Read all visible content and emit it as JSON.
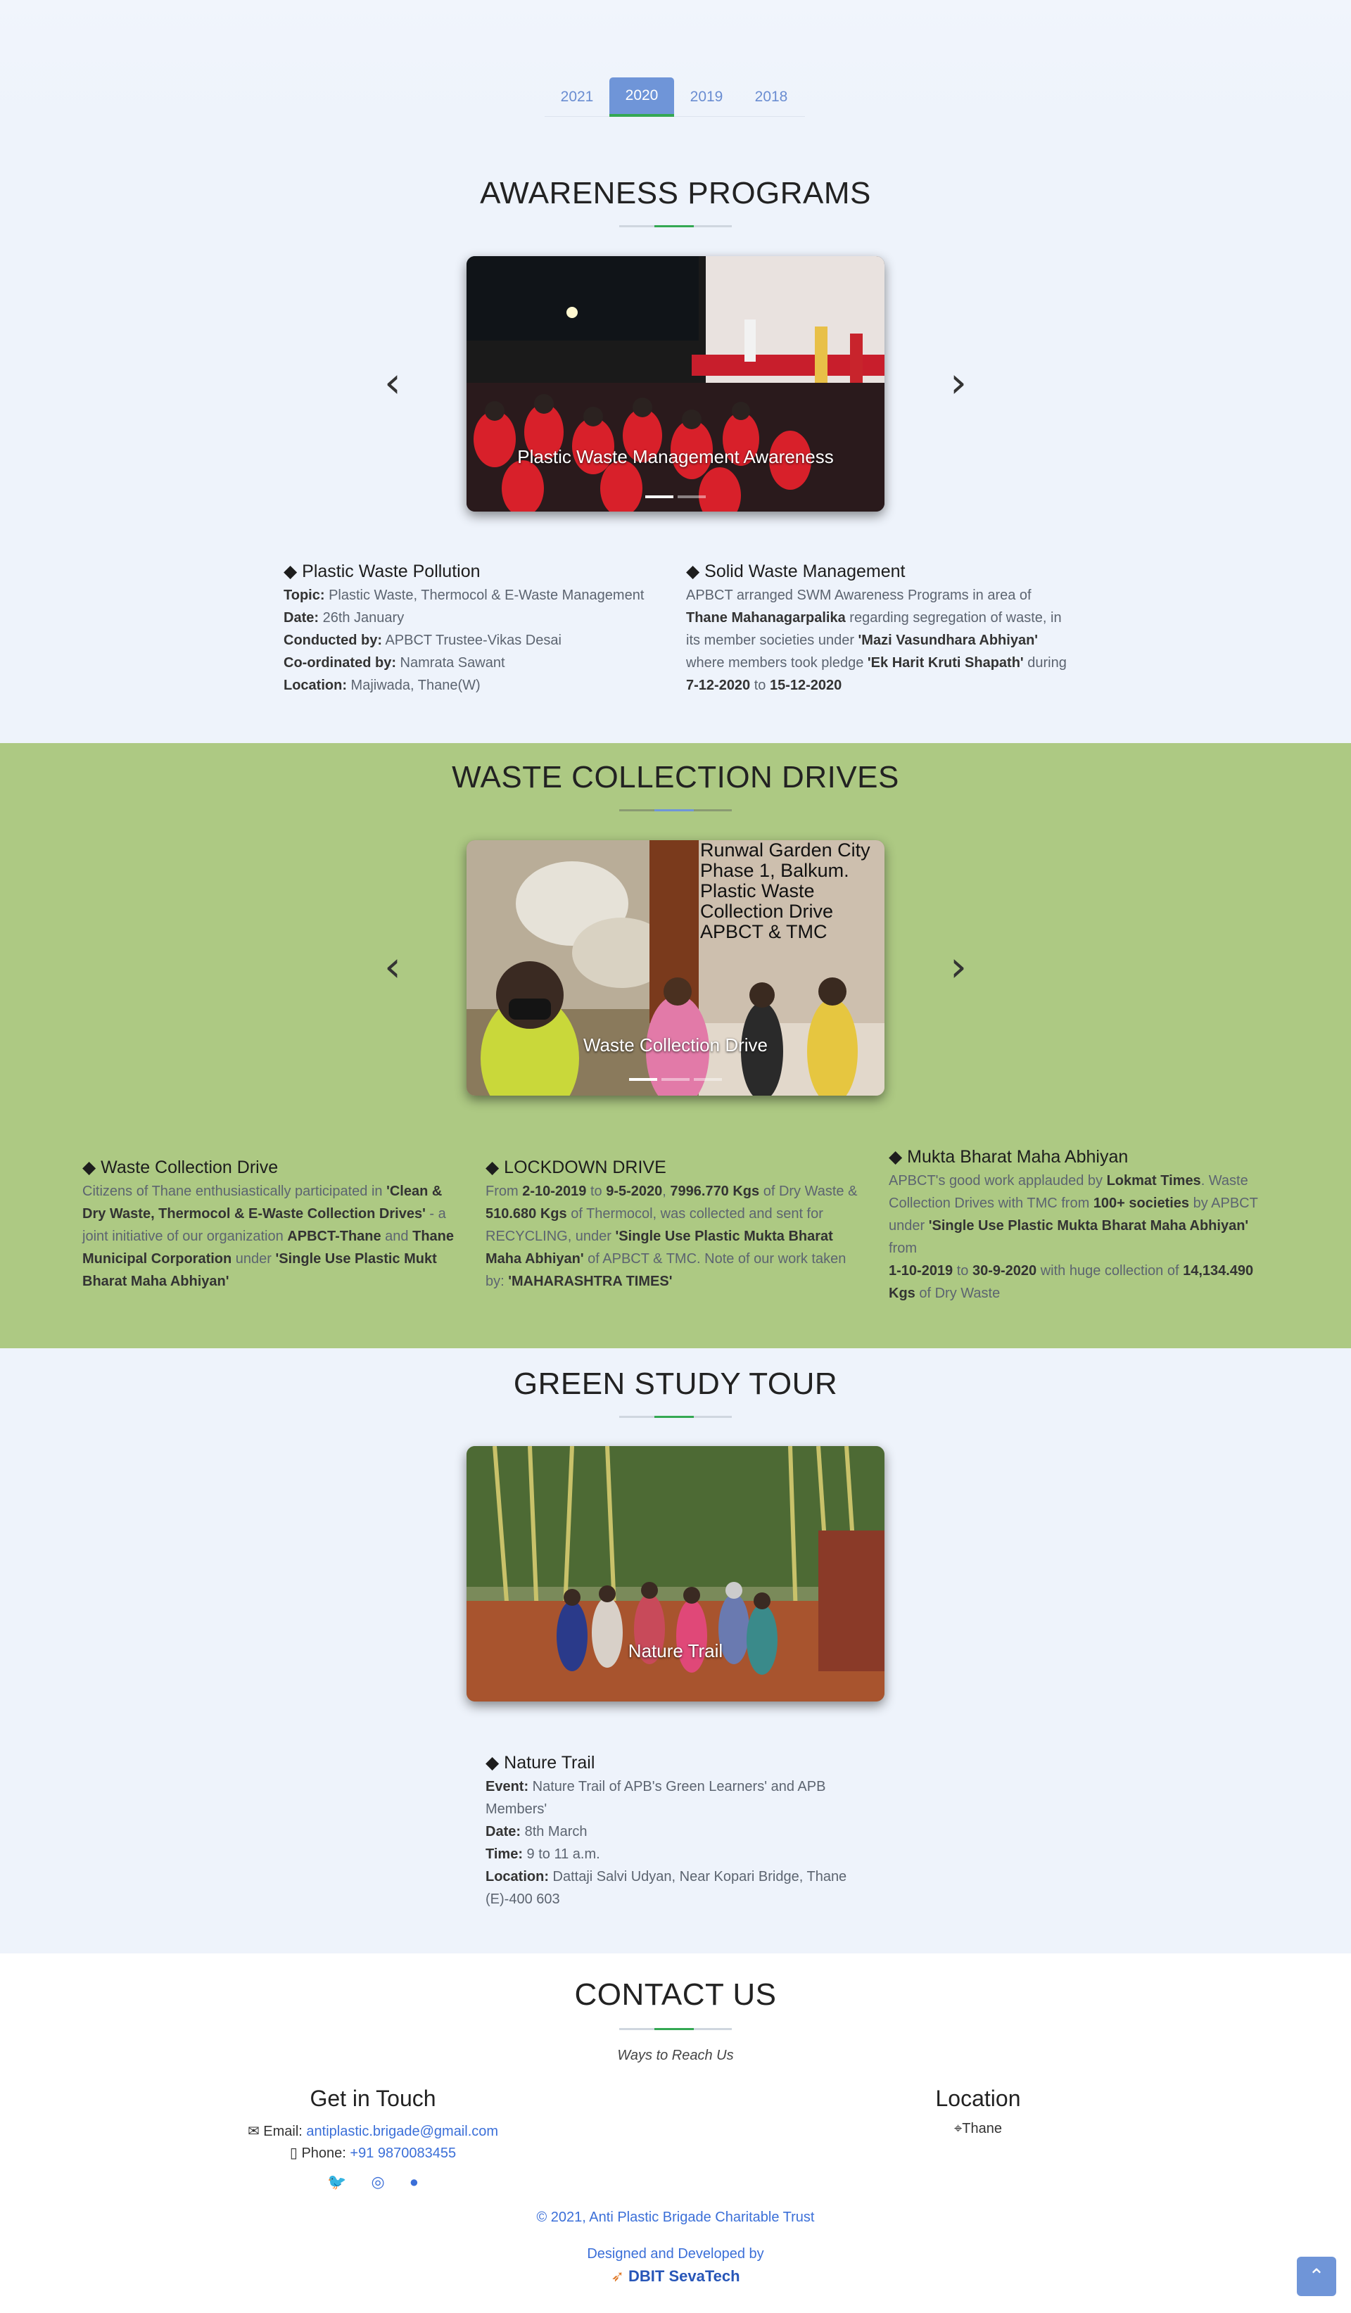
{
  "tabs": [
    "2021",
    "2020",
    "2019",
    "2018"
  ],
  "active_tab": "2020",
  "awareness": {
    "title": "AWARENESS PROGRAMS",
    "caption": "Plastic Waste Management Awareness",
    "left": {
      "heading": "Plastic Waste Pollution",
      "topic_k": "Topic:",
      "topic_v": " Plastic Waste, Thermocol & E-Waste Management",
      "date_k": "Date:",
      "date_v": " 26th January",
      "conducted_k": "Conducted by:",
      "conducted_v": " APBCT Trustee-Vikas Desai",
      "coord_k": "Co-ordinated by:",
      "coord_v": " Namrata Sawant",
      "loc_k": "Location:",
      "loc_v": " Majiwada, Thane(W)"
    },
    "right": {
      "heading": "Solid Waste Management",
      "p1": "APBCT arranged SWM Awareness Programs in area of ",
      "b1": "Thane Mahanagarpalika",
      "p2": " regarding segregation of waste, in its member societies under ",
      "b2": "'Mazi Vasundhara Abhiyan'",
      "p3": " where members took pledge ",
      "b3": "'Ek Harit Kruti Shapath'",
      "p4": " during ",
      "b4": "7-12-2020",
      "p5": " to ",
      "b5": "15-12-2020"
    }
  },
  "waste": {
    "title": "WASTE COLLECTION DRIVES",
    "caption": "Waste Collection Drive",
    "overlay_lines": [
      "Runwal Garden City",
      "Phase 1, Balkum.",
      "Plastic Waste",
      "Collection Drive",
      "APBCT & TMC"
    ],
    "col1": {
      "heading": "Waste Collection Drive",
      "p1": "Citizens of Thane enthusiastically participated in ",
      "b1": "'Clean & Dry Waste, Thermocol & E-Waste Collection Drives'",
      "p2": " - a joint initiative of our organization ",
      "b2": "APBCT-Thane",
      "p3": " and ",
      "b3": "Thane Municipal Corporation",
      "p4": " under ",
      "b4": "'Single Use Plastic Mukt Bharat Maha Abhiyan'"
    },
    "col2": {
      "heading": "LOCKDOWN DRIVE",
      "p1": "From ",
      "b1": "2-10-2019",
      "p2": " to ",
      "b2": "9-5-2020",
      "p3": ", ",
      "b3": "7996.770 Kgs",
      "p4": " of Dry Waste & ",
      "b4": "510.680 Kgs",
      "p5": " of Thermocol, was collected and sent for RECYCLING, under   ",
      "b5": "'Single Use Plastic Mukta Bharat Maha Abhiyan'",
      "p6": " of APBCT & TMC. Note of our work taken by: ",
      "b6": "'MAHARASHTRA TIMES'"
    },
    "col3": {
      "heading": "Mukta Bharat Maha Abhiyan",
      "p1": "APBCT's good work applauded by ",
      "b1": "Lokmat Times",
      "p2": ". Waste Collection Drives with TMC from ",
      "b2": "100+ societies",
      "p3": " by APBCT under ",
      "b3": "'Single Use Plastic Mukta Bharat Maha Abhiyan'",
      "p4": " from",
      "b4": "1-10-2019",
      "p5": " to ",
      "b5": "30-9-2020",
      "p6": " with huge collection of ",
      "b6": "14,134.490 Kgs",
      "p7": " of Dry Waste"
    }
  },
  "tour": {
    "title": "GREEN STUDY TOUR",
    "caption": "Nature Trail",
    "heading": "Nature Trail",
    "event_k": "Event:",
    "event_v": " Nature Trail of APB's Green Learners' and APB Members'",
    "date_k": "Date:",
    "date_v": " 8th March",
    "time_k": "Time:",
    "time_v": " 9 to 11 a.m.",
    "loc_k": "Location:",
    "loc_v": " Dattaji Salvi Udyan, Near Kopari Bridge, Thane (E)-400 603"
  },
  "contact": {
    "title": "CONTACT US",
    "subtitle": "Ways to Reach Us",
    "touch_heading": "Get in Touch",
    "email_label": "Email: ",
    "email": "antiplastic.brigade@gmail.com",
    "phone_label": "Phone: ",
    "phone": "+91 9870083455",
    "location_heading": "Location",
    "location": "Thane",
    "copyright": "© 2021, Anti Plastic Brigade Charitable Trust",
    "designed": "Designed and Developed by",
    "brand": "DBIT SevaTech"
  },
  "colors": {
    "accent_blue": "#6f95d8",
    "accent_green": "#34a853",
    "band_green": "#adc983",
    "link": "#3b6fd8"
  }
}
